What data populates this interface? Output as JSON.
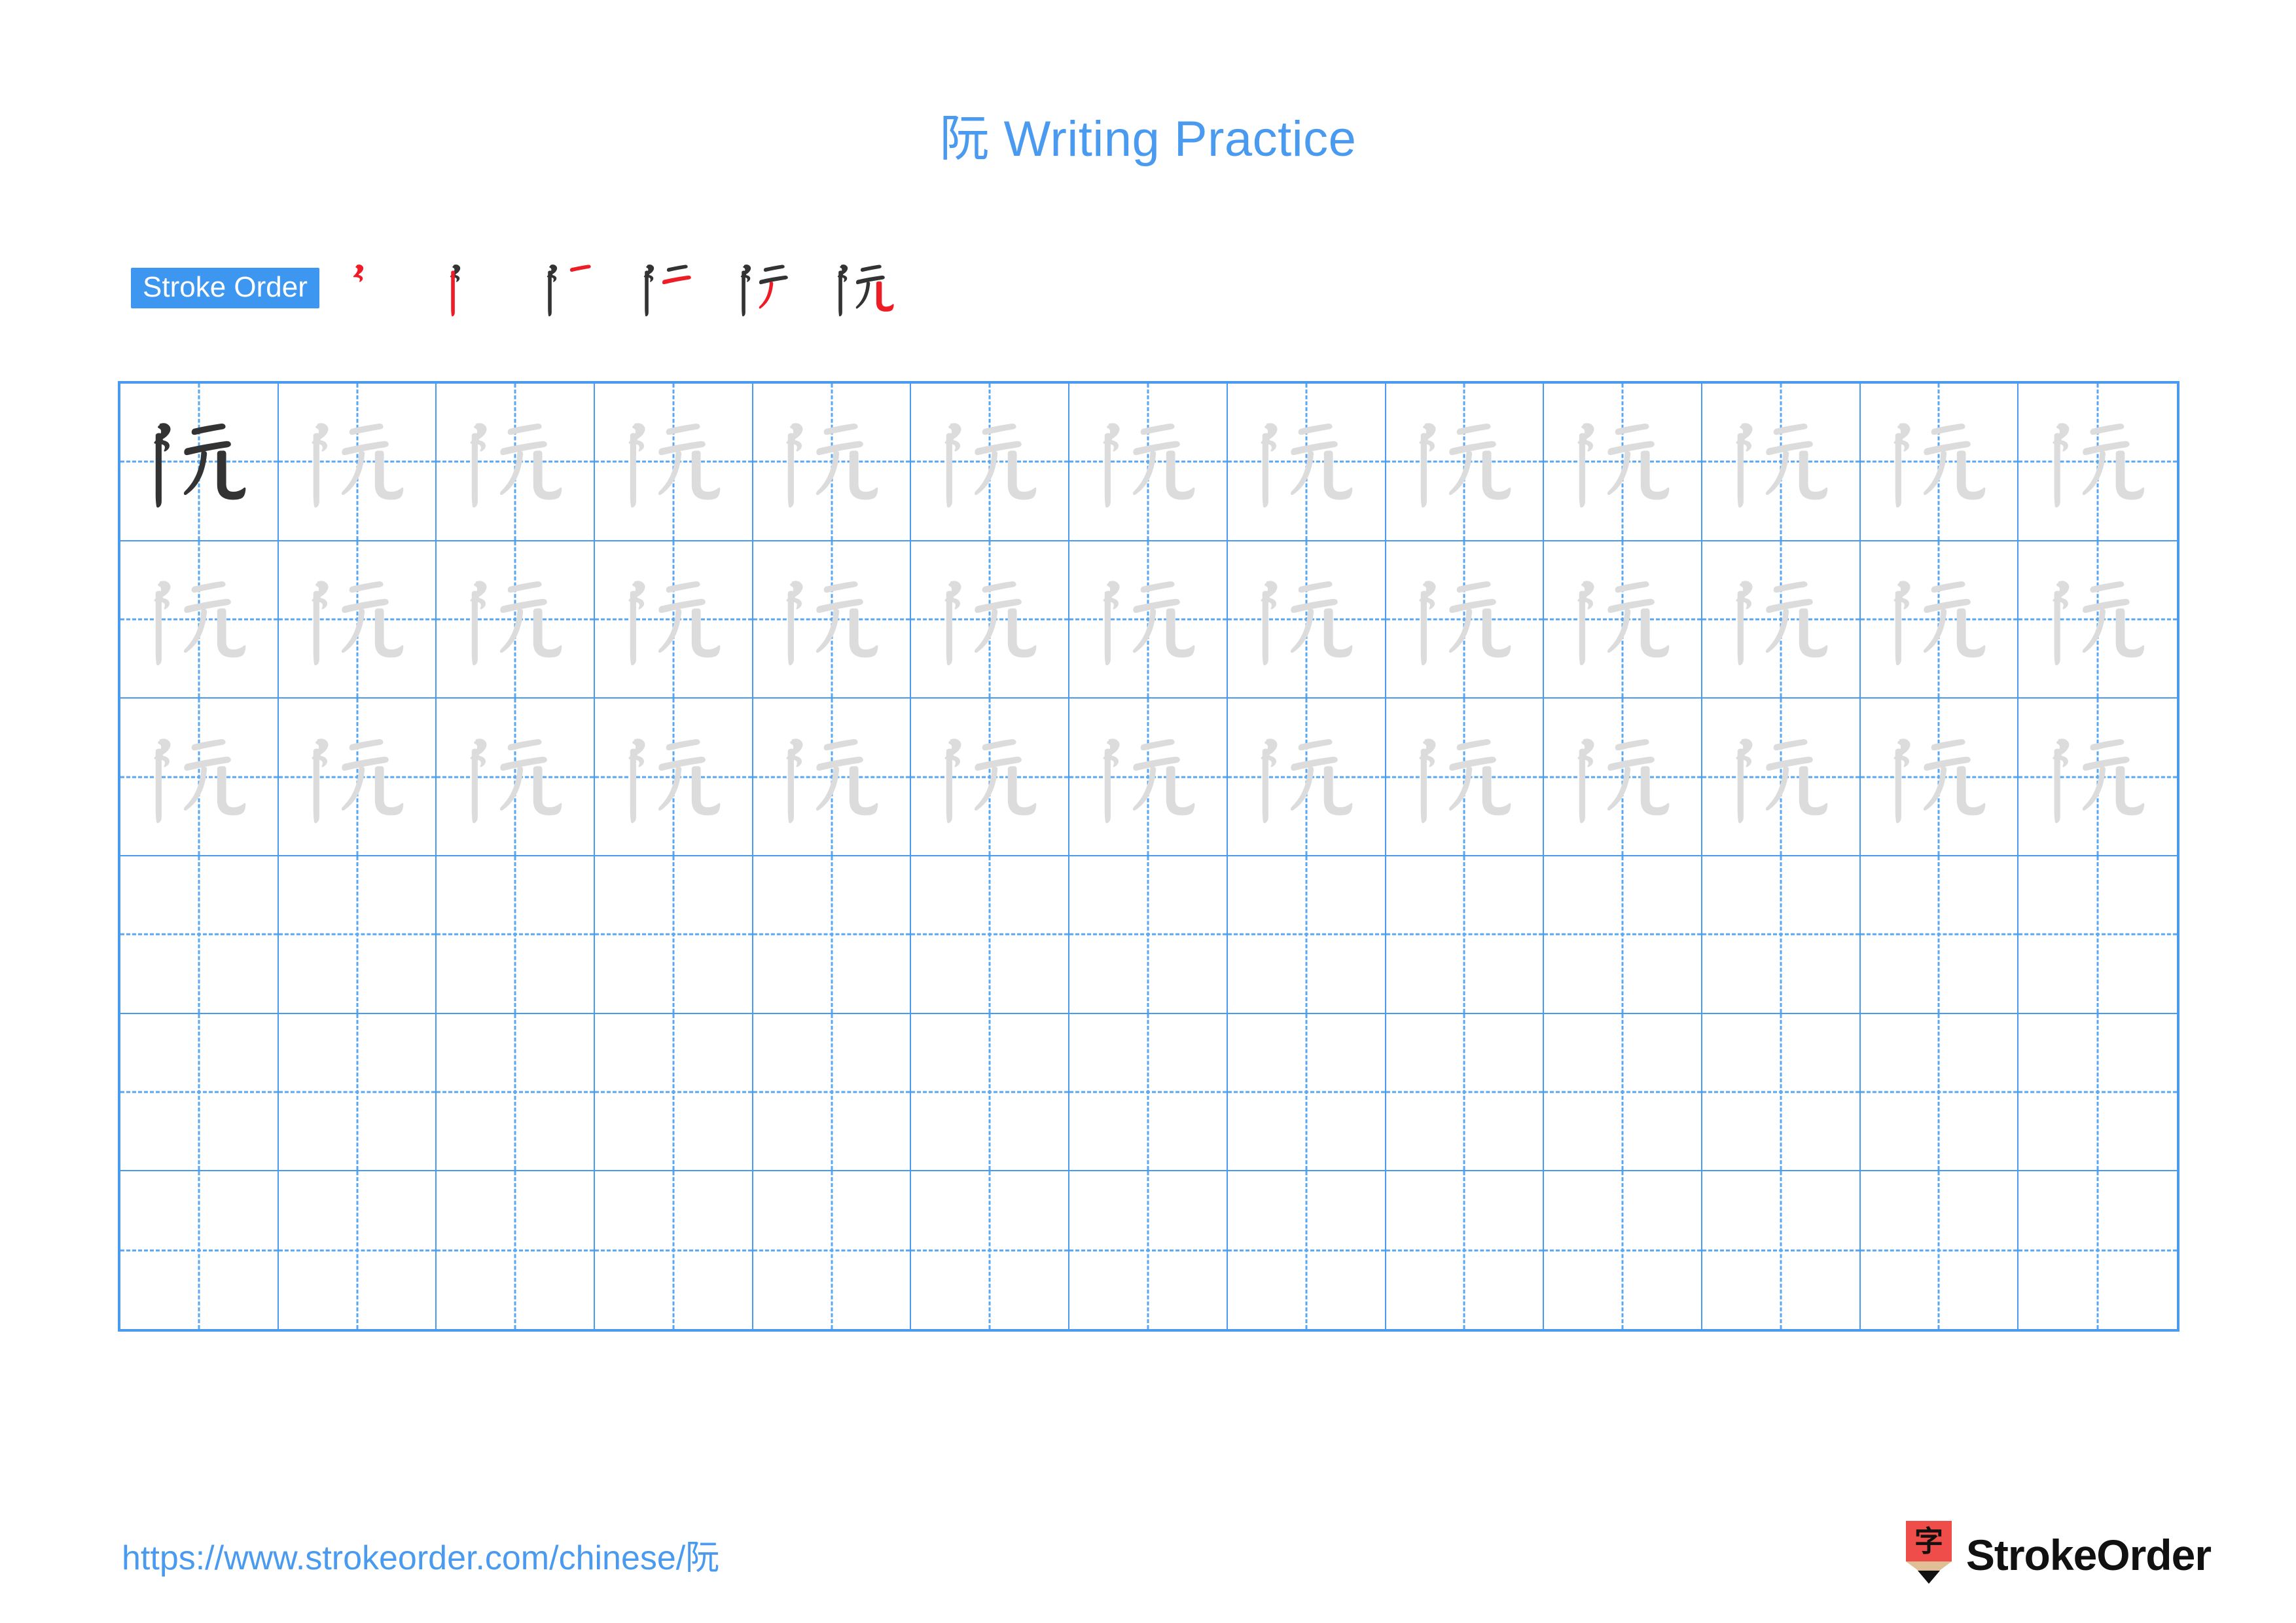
{
  "page": {
    "character": "阮",
    "title": "阮 Writing Practice",
    "background_color": "#ffffff",
    "accent_color": "#4a9bf0"
  },
  "stroke_order": {
    "badge_label": "Stroke Order",
    "badge_bg_color": "#3d97f0",
    "badge_text_color": "#ffffff",
    "new_stroke_color": "#ee1c25",
    "done_stroke_color": "#333333",
    "total_strokes": 6,
    "steps": [
      {
        "index": 1,
        "strokes_shown": 1
      },
      {
        "index": 2,
        "strokes_shown": 2
      },
      {
        "index": 3,
        "strokes_shown": 3
      },
      {
        "index": 4,
        "strokes_shown": 4
      },
      {
        "index": 5,
        "strokes_shown": 5
      },
      {
        "index": 6,
        "strokes_shown": 6
      }
    ]
  },
  "practice_grid": {
    "columns": 13,
    "rows": 6,
    "grid_line_color": "#4a9bf0",
    "guide_line_color": "#5aa7f2",
    "dark_char_color": "#333333",
    "light_char_color": "#dcdcdc",
    "row_fill": [
      "dark-then-light",
      "light",
      "light",
      "empty",
      "empty",
      "empty"
    ]
  },
  "footer": {
    "url": "https://www.strokeorder.com/chinese/阮",
    "brand_name": "StrokeOrder",
    "brand_mark_char": "字",
    "brand_mark_body_color": "#ef4d4a",
    "brand_mark_wood_color": "#e0bf96",
    "brand_mark_tip_color": "#111111"
  }
}
